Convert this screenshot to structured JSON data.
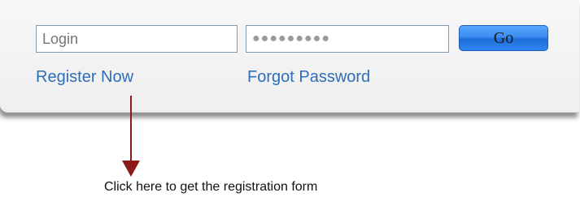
{
  "login": {
    "username_placeholder": "Login",
    "password_value": "●●●●●●●●●",
    "go_label": "Go"
  },
  "links": {
    "register": "Register Now",
    "forgot_password": "Forgot Password"
  },
  "annotation": {
    "caption": "Click here to get the registration form",
    "arrow_color": "#8b1a1a"
  },
  "colors": {
    "link": "#2e6eb8",
    "button_accent": "#3a8cf0"
  }
}
